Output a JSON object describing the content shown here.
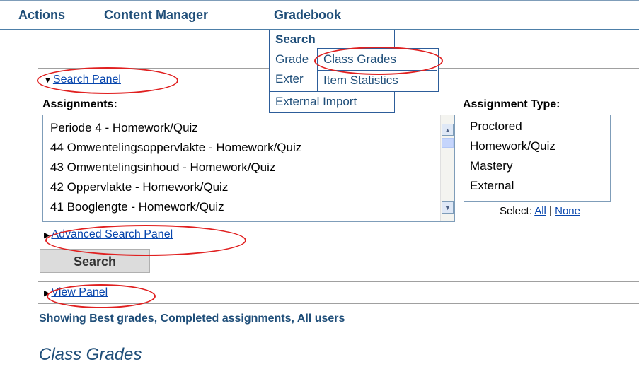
{
  "menubar": {
    "items": [
      "Actions",
      "Content Manager",
      "Gradebook"
    ]
  },
  "dropdown": {
    "header": "Search",
    "items": [
      "Grade",
      "Exter",
      "External Import"
    ]
  },
  "submenu": {
    "items": [
      "Class Grades",
      "Item Statistics"
    ]
  },
  "search_panel": {
    "toggle_label": "Search Panel",
    "assignments_label": "Assignments:",
    "assignments": [
      "Periode 4 - Homework/Quiz",
      "44 Omwentelingsoppervlakte - Homework/Quiz",
      "43 Omwentelingsinhoud - Homework/Quiz",
      "42 Oppervlakte - Homework/Quiz",
      "41 Booglengte - Homework/Quiz"
    ],
    "type_label": "Assignment Type:",
    "types": [
      "Proctored",
      "Homework/Quiz",
      "Mastery",
      "External"
    ],
    "select_label": "Select:",
    "select_all": "All",
    "select_sep": "|",
    "select_none": "None",
    "advanced_toggle": "Advanced Search Panel",
    "search_button": "Search"
  },
  "view_panel": {
    "toggle_label": "View Panel"
  },
  "status": "Showing Best grades, Completed assignments, All users",
  "section_title": "Class Grades",
  "icons": {
    "expanded": "triangle-down-icon",
    "collapsed": "triangle-right-icon",
    "scroll_up": "scroll-up-icon",
    "scroll_down": "scroll-down-icon"
  },
  "colors": {
    "link": "#0645ad",
    "heading": "#1f4e79",
    "highlight": "#e02020"
  }
}
